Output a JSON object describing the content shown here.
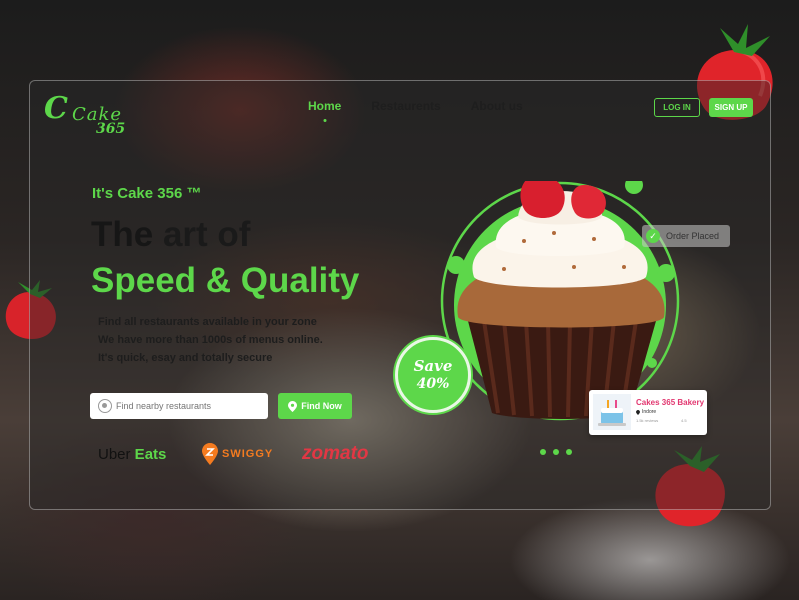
{
  "brand": {
    "logo_main": "Cake",
    "logo_sub": "365"
  },
  "nav": {
    "items": [
      {
        "label": "Home",
        "active": true
      },
      {
        "label": "Restaurents",
        "active": false
      },
      {
        "label": "About us",
        "active": false
      }
    ]
  },
  "auth": {
    "login_label": "LOG IN",
    "signup_label": "SIGN UP"
  },
  "hero": {
    "kicker": "It's Cake 356 ™",
    "title_line1_a": "The",
    "title_line1_b": " art of",
    "title_line2": "Speed & Quality",
    "desc_line1": "Find all restaurants available in your zone",
    "desc_line2": "We have more than 1000s of menus online.",
    "desc_line3": "It's quick, esay and totally secure"
  },
  "search": {
    "placeholder": "Find nearby restaurants",
    "button_label": "Find Now"
  },
  "partners": {
    "uber_a": "Uber",
    "uber_b": " Eats",
    "swiggy": "SWIGGY",
    "zomato": "zomato"
  },
  "promo": {
    "save_text": "Save",
    "discount_text": "40%"
  },
  "order_status": {
    "label": "Order Placed"
  },
  "bakery_card": {
    "name": "Cakes 365 Bakery",
    "location": "Indore",
    "meta": "1.5k reviews",
    "rating": "4.5"
  },
  "colors": {
    "accent": "#5dd74a",
    "zomato": "#e23744",
    "swiggy": "#f47b20",
    "bakery_name": "#e23770"
  },
  "icons": [
    "search-location-icon",
    "map-pin-icon",
    "check-icon",
    "swiggy-logo-icon",
    "strawberry-icon"
  ]
}
